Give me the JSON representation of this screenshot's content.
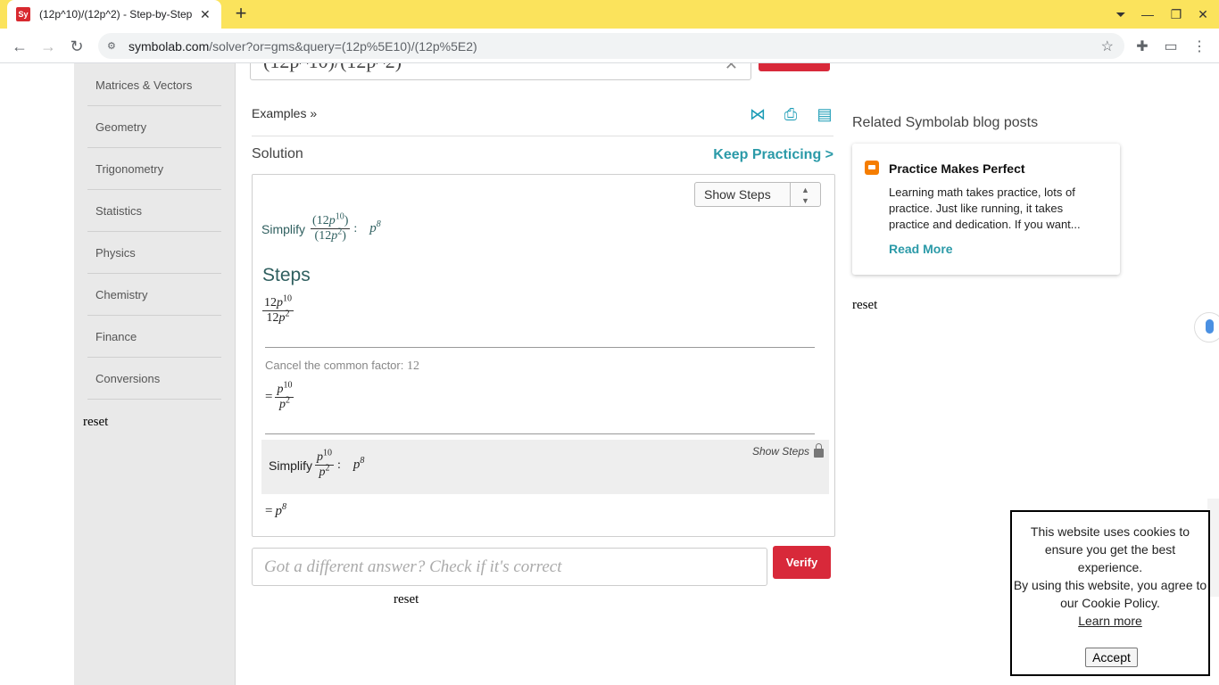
{
  "browser": {
    "tab_title": "(12p^10)/(12p^2) - Step-by-Step",
    "favicon": "Sy",
    "url_host": "symbolab.com",
    "url_path": "/solver?or=gms&query=(12p%5E10)/(12p%5E2)"
  },
  "sidebar": {
    "items": [
      "Matrices & Vectors",
      "Geometry",
      "Trigonometry",
      "Statistics",
      "Physics",
      "Chemistry",
      "Finance",
      "Conversions"
    ],
    "reset": "reset"
  },
  "main": {
    "input_value": "(12p^10)/(12p^2)",
    "examples": "Examples »",
    "solution_label": "Solution",
    "keep_practicing": "Keep Practicing >",
    "show_steps_select": "Show Steps",
    "simplify_label": "Simplify",
    "steps_title": "Steps",
    "cancel_text": "Cancel the common factor:",
    "cancel_factor": "12",
    "show_steps_link": "Show Steps",
    "verify_placeholder": "Got a different answer? Check if it's correct",
    "verify_button": "Verify",
    "reset": "reset",
    "math": {
      "coef": "12",
      "var": "p",
      "exp_num": "10",
      "exp_den": "2",
      "result_exp": "8",
      "eq": "="
    }
  },
  "right": {
    "related_title": "Related Symbolab blog posts",
    "blog_title": "Practice Makes Perfect",
    "blog_body": "Learning math takes practice, lots of practice. Just like running, it takes practice and dedication. If you want...",
    "read_more": "Read More",
    "reset": "reset"
  },
  "cookie": {
    "line1": "This website uses cookies to ensure you get the best experience.",
    "line2": "By using this website, you agree to our Cookie Policy.",
    "learn_more": "Learn more",
    "accept": "Accept"
  },
  "colors": {
    "tabbar": "#fbe35c",
    "brand_red": "#d8293a",
    "teal": "#2b9aa8"
  }
}
